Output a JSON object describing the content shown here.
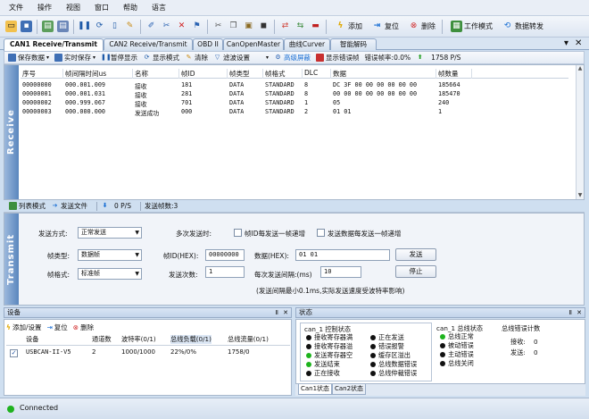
{
  "menu": [
    "文件",
    "操作",
    "视图",
    "窗口",
    "帮助",
    "语言"
  ],
  "toolbar": {
    "add_label": "添加",
    "reset_label": "复位",
    "delete_label": "删除",
    "work_mode_label": "工作模式",
    "data_forward_label": "数据转发"
  },
  "tabs": [
    "CAN1 Receive/Transmit",
    "CAN2 Receive/Transmit",
    "OBD II",
    "CanOpenMaster",
    "曲线Curver",
    "智能解码"
  ],
  "receive_toolbar": {
    "save_data": "保存数据",
    "realtime_save": "实时保存",
    "pause_display": "暂停显示",
    "display_mode": "显示模式",
    "clear": "清除",
    "filter_settings": "滤波设置",
    "advanced_mask": "高级屏蔽",
    "show_error_frames": "显示错误帧",
    "error_rate": "错误帧率:0.0%",
    "rate": "1758 P/S"
  },
  "receive": {
    "side_label": "Receive",
    "columns": [
      "序号",
      "帧间隔时间us",
      "名称",
      "帧ID",
      "帧类型",
      "帧格式",
      "DLC",
      "数据",
      "帧数量"
    ],
    "rows": [
      [
        "00000000",
        "000.001.009",
        "接收",
        "181",
        "DATA",
        "STANDARD",
        "8",
        "DC 3F 00 00 00 00 00 00",
        "185664"
      ],
      [
        "00000001",
        "000.001.031",
        "接收",
        "281",
        "DATA",
        "STANDARD",
        "8",
        "00 00 00 00 00 00 00 00",
        "185470"
      ],
      [
        "00000002",
        "000.999.067",
        "接收",
        "701",
        "DATA",
        "STANDARD",
        "1",
        "05",
        "240"
      ],
      [
        "00000003",
        "000.000.000",
        "发送成功",
        "000",
        "DATA",
        "STANDARD",
        "2",
        "01 01",
        "1"
      ]
    ]
  },
  "midbar": {
    "list_mode": "列表模式",
    "send_file": "发送文件",
    "rate": "0 P/S",
    "send_frames": "发送帧数:3"
  },
  "transmit": {
    "side_label": "Transmit",
    "send_mode_label": "发送方式:",
    "send_mode_value": "正常发送",
    "multi_send_label": "多次发送时:",
    "id_inc_label": "帧ID每发送一帧递增",
    "data_inc_label": "发送数据每发送一帧递增",
    "frame_type_label": "帧类型:",
    "frame_type_value": "数据帧",
    "frame_id_label": "帧ID(HEX):",
    "frame_id_value": "00000000",
    "data_label": "数据(HEX):",
    "data_value": "01 01",
    "send_button": "发送",
    "frame_format_label": "帧格式:",
    "frame_format_value": "标准帧",
    "send_count_label": "发送次数:",
    "send_count_value": "1",
    "interval_label": "每次发送间隔:(ms)",
    "interval_value": "10",
    "stop_button": "停止",
    "note": "(发送间隔最小0.1ms,实际发送速度受波特率影响)"
  },
  "device": {
    "title": "设备",
    "add_settings": "添加/设置",
    "reset": "复位",
    "delete": "删除",
    "columns": [
      "设备",
      "通道数",
      "波特率(0/1)",
      "总线负载(0/1)",
      "总线流量(0/1)"
    ],
    "rows": [
      [
        "USBCAN-II-V5",
        "2",
        "1000/1000",
        "22%/0%",
        "1758/0"
      ]
    ]
  },
  "status": {
    "title": "状态",
    "can1_ctrl_label": "can_1 控制状态",
    "ctrl_left": [
      "接收寄存器满",
      "接收寄存器溢",
      "发送寄存器空",
      "发送结束",
      "正在接收"
    ],
    "ctrl_right": [
      "正在发送",
      "错误报警",
      "缓存区溢出",
      "总线数据错误",
      "总线仲裁错误"
    ],
    "bus_state_label": "can_1 总线状态",
    "bus_states": [
      "总线正常",
      "被动错误",
      "主动错误",
      "总线关闭"
    ],
    "error_count_label": "总线错误计数",
    "rx_label": "接收:",
    "rx_value": "0",
    "tx_label": "发送:",
    "tx_value": "0",
    "tab_can1": "Can1状态",
    "tab_can2": "Can2状态"
  },
  "statusbar": {
    "connected": "Connected"
  },
  "colors": {
    "accent": "#1a6fd4",
    "connected": "#1fb21f",
    "side_panel": "#5a86bd"
  }
}
